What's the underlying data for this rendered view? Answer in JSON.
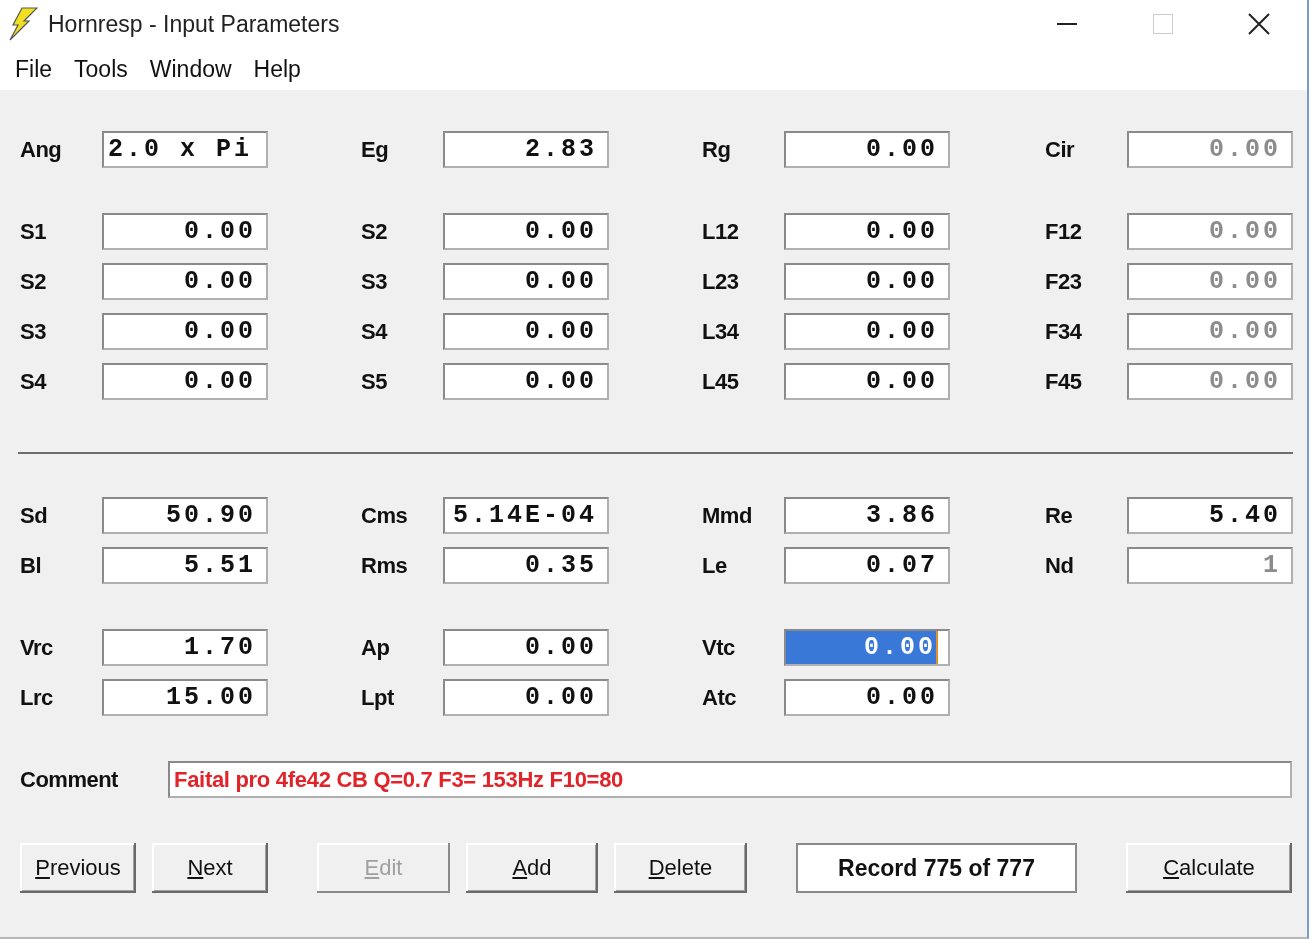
{
  "window": {
    "title": "Hornresp - Input Parameters"
  },
  "menu": [
    "File",
    "Tools",
    "Window",
    "Help"
  ],
  "groups": [
    {
      "rule_above": false,
      "rows": [
        [
          {
            "label": "Ang",
            "value": "2.0 x Pi",
            "kind": "choice",
            "disabled": false,
            "selected": false
          },
          {
            "label": "Eg",
            "value": "2.83",
            "kind": "number",
            "disabled": false,
            "selected": false
          },
          {
            "label": "Rg",
            "value": "0.00",
            "kind": "number",
            "disabled": false,
            "selected": false
          },
          {
            "label": "Cir",
            "value": "0.00",
            "kind": "number",
            "disabled": true,
            "selected": false
          }
        ]
      ]
    },
    {
      "rule_above": false,
      "rows": [
        [
          {
            "label": "S1",
            "value": "0.00",
            "kind": "number",
            "disabled": false,
            "selected": false
          },
          {
            "label": "S2",
            "value": "0.00",
            "kind": "number",
            "disabled": false,
            "selected": false
          },
          {
            "label": "L12",
            "value": "0.00",
            "kind": "number",
            "disabled": false,
            "selected": false
          },
          {
            "label": "F12",
            "value": "0.00",
            "kind": "number",
            "disabled": true,
            "selected": false
          }
        ],
        [
          {
            "label": "S2",
            "value": "0.00",
            "kind": "number",
            "disabled": false,
            "selected": false
          },
          {
            "label": "S3",
            "value": "0.00",
            "kind": "number",
            "disabled": false,
            "selected": false
          },
          {
            "label": "L23",
            "value": "0.00",
            "kind": "number",
            "disabled": false,
            "selected": false
          },
          {
            "label": "F23",
            "value": "0.00",
            "kind": "number",
            "disabled": true,
            "selected": false
          }
        ],
        [
          {
            "label": "S3",
            "value": "0.00",
            "kind": "number",
            "disabled": false,
            "selected": false
          },
          {
            "label": "S4",
            "value": "0.00",
            "kind": "number",
            "disabled": false,
            "selected": false
          },
          {
            "label": "L34",
            "value": "0.00",
            "kind": "number",
            "disabled": false,
            "selected": false
          },
          {
            "label": "F34",
            "value": "0.00",
            "kind": "number",
            "disabled": true,
            "selected": false
          }
        ],
        [
          {
            "label": "S4",
            "value": "0.00",
            "kind": "number",
            "disabled": false,
            "selected": false
          },
          {
            "label": "S5",
            "value": "0.00",
            "kind": "number",
            "disabled": false,
            "selected": false
          },
          {
            "label": "L45",
            "value": "0.00",
            "kind": "number",
            "disabled": false,
            "selected": false
          },
          {
            "label": "F45",
            "value": "0.00",
            "kind": "number",
            "disabled": true,
            "selected": false
          }
        ]
      ]
    },
    {
      "rule_above": true,
      "rows": [
        [
          {
            "label": "Sd",
            "value": "50.90",
            "kind": "number",
            "disabled": false,
            "selected": false
          },
          {
            "label": "Cms",
            "value": "5.14E-04",
            "kind": "number",
            "disabled": false,
            "selected": false
          },
          {
            "label": "Mmd",
            "value": "3.86",
            "kind": "number",
            "disabled": false,
            "selected": false
          },
          {
            "label": "Re",
            "value": "5.40",
            "kind": "number",
            "disabled": false,
            "selected": false
          }
        ],
        [
          {
            "label": "Bl",
            "value": "5.51",
            "kind": "number",
            "disabled": false,
            "selected": false
          },
          {
            "label": "Rms",
            "value": "0.35",
            "kind": "number",
            "disabled": false,
            "selected": false
          },
          {
            "label": "Le",
            "value": "0.07",
            "kind": "number",
            "disabled": false,
            "selected": false
          },
          {
            "label": "Nd",
            "value": "1",
            "kind": "number",
            "disabled": true,
            "selected": false
          }
        ]
      ]
    },
    {
      "rule_above": false,
      "rows": [
        [
          {
            "label": "Vrc",
            "value": "1.70",
            "kind": "number",
            "disabled": false,
            "selected": false
          },
          {
            "label": "Ap",
            "value": "0.00",
            "kind": "number",
            "disabled": false,
            "selected": false
          },
          {
            "label": "Vtc",
            "value": "0.00",
            "kind": "number",
            "disabled": false,
            "selected": true
          }
        ],
        [
          {
            "label": "Lrc",
            "value": "15.00",
            "kind": "number",
            "disabled": false,
            "selected": false
          },
          {
            "label": "Lpt",
            "value": "0.00",
            "kind": "number",
            "disabled": false,
            "selected": false
          },
          {
            "label": "Atc",
            "value": "0.00",
            "kind": "number",
            "disabled": false,
            "selected": false
          }
        ]
      ]
    }
  ],
  "comment": {
    "label": "Comment",
    "value": "Faital pro 4fe42 CB Q=0.7 F3= 153Hz F10=80"
  },
  "buttons": [
    {
      "kind": "button",
      "label": "Previous",
      "disabled": false
    },
    {
      "kind": "button",
      "label": "Next",
      "disabled": false
    },
    {
      "kind": "button",
      "label": "Edit",
      "disabled": true
    },
    {
      "kind": "button",
      "label": "Add",
      "disabled": false
    },
    {
      "kind": "button",
      "label": "Delete",
      "disabled": false
    },
    {
      "kind": "display",
      "label": "Record 775 of 777"
    },
    {
      "kind": "button",
      "label": "Calculate",
      "disabled": false
    }
  ]
}
